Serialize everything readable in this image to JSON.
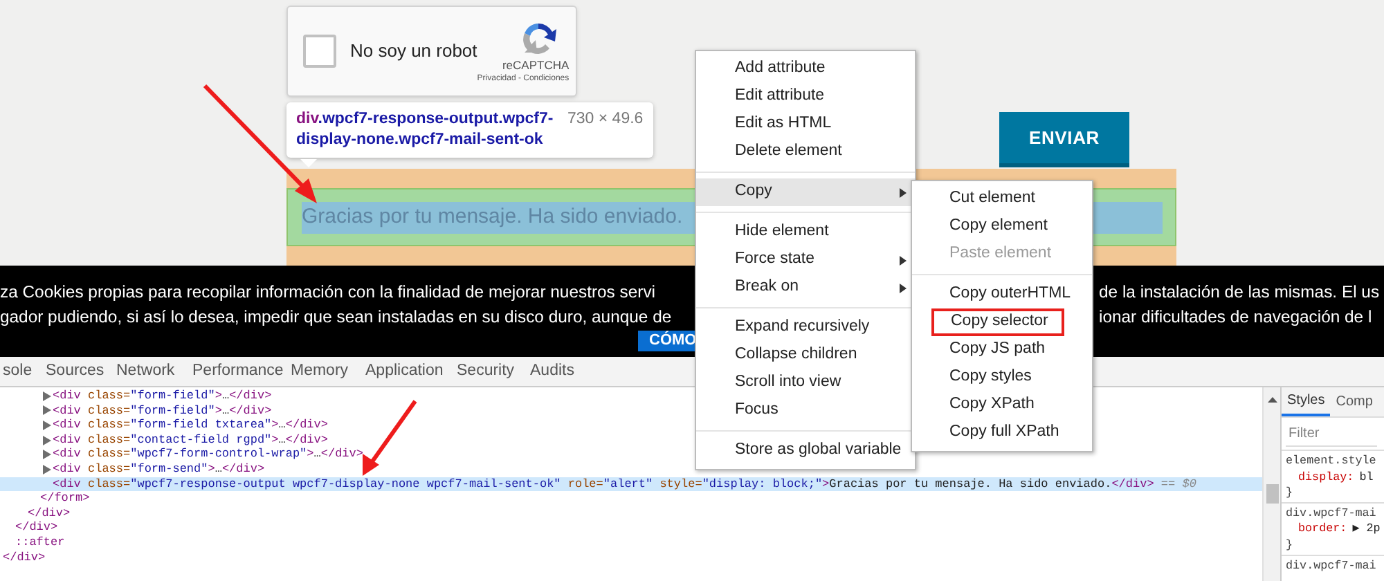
{
  "recaptcha": {
    "label": "No soy un robot",
    "checked": false,
    "brand": "reCAPTCHA",
    "links": "Privacidad - Condiciones"
  },
  "inspect_tooltip": {
    "tag": "div",
    "classes": ".wpcf7-response-output.wpcf7-display-none.wpcf7-mail-sent-ok",
    "size": "730 × 49.6"
  },
  "send_button": {
    "label": "ENVIAR"
  },
  "response_message": "Gracias por tu mensaje. Ha sido enviado.",
  "cookie_banner": {
    "line_1_left": "za Cookies propias para recopilar información con la finalidad de mejorar nuestros servi",
    "line_1_right": "de la instalación de las mismas. El us",
    "line_2_left": "gador pudiendo, si así lo desea, impedir que sean instaladas en su disco duro, aunque de",
    "line_2_right": "ionar dificultades de navegación de l",
    "button": "CÓMO"
  },
  "devtools_tabs": [
    {
      "label": "sole",
      "selected": false
    },
    {
      "label": "Sources",
      "selected": false
    },
    {
      "label": "Network",
      "selected": false
    },
    {
      "label": "Performance",
      "selected": false
    },
    {
      "label": "Memory",
      "selected": false
    },
    {
      "label": "Application",
      "selected": false
    },
    {
      "label": "Security",
      "selected": false
    },
    {
      "label": "Audits",
      "selected": false
    }
  ],
  "dom_tree": [
    {
      "close": [
        {
          "kind": "tag",
          "text": "</div>"
        }
      ],
      "children": [
        {
          "close": [
            {
              "kind": "tag",
              "text": "</div>"
            }
          ],
          "children": [
            {
              "close": [
                {
                  "kind": "tag",
                  "text": "</div>"
                }
              ],
              "children": [
                {
                  "close": [
                    {
                      "kind": "tag",
                      "text": "</form>"
                    }
                  ],
                  "children": [
                    {
                      "expandable": true,
                      "selected": false,
                      "open": [
                        {
                          "kind": "tag",
                          "text": "<div"
                        },
                        {
                          "kind": "attr",
                          "text": " class="
                        },
                        {
                          "kind": "value",
                          "text": "\"form-field\""
                        },
                        {
                          "kind": "tag",
                          "text": ">"
                        },
                        {
                          "kind": "text",
                          "text": "…"
                        },
                        {
                          "kind": "tag",
                          "text": "</div>"
                        }
                      ]
                    },
                    {
                      "expandable": true,
                      "selected": false,
                      "open": [
                        {
                          "kind": "tag",
                          "text": "<div"
                        },
                        {
                          "kind": "attr",
                          "text": " class="
                        },
                        {
                          "kind": "value",
                          "text": "\"form-field\""
                        },
                        {
                          "kind": "tag",
                          "text": ">"
                        },
                        {
                          "kind": "text",
                          "text": "…"
                        },
                        {
                          "kind": "tag",
                          "text": "</div>"
                        }
                      ]
                    },
                    {
                      "expandable": true,
                      "selected": false,
                      "open": [
                        {
                          "kind": "tag",
                          "text": "<div"
                        },
                        {
                          "kind": "attr",
                          "text": " class="
                        },
                        {
                          "kind": "value",
                          "text": "\"form-field txtarea\""
                        },
                        {
                          "kind": "tag",
                          "text": ">"
                        },
                        {
                          "kind": "text",
                          "text": "…"
                        },
                        {
                          "kind": "tag",
                          "text": "</div>"
                        }
                      ]
                    },
                    {
                      "expandable": true,
                      "selected": false,
                      "open": [
                        {
                          "kind": "tag",
                          "text": "<div"
                        },
                        {
                          "kind": "attr",
                          "text": " class="
                        },
                        {
                          "kind": "value",
                          "text": "\"contact-field rgpd\""
                        },
                        {
                          "kind": "tag",
                          "text": ">"
                        },
                        {
                          "kind": "text",
                          "text": "…"
                        },
                        {
                          "kind": "tag",
                          "text": "</div>"
                        }
                      ]
                    },
                    {
                      "expandable": true,
                      "selected": false,
                      "open": [
                        {
                          "kind": "tag",
                          "text": "<div"
                        },
                        {
                          "kind": "attr",
                          "text": " class="
                        },
                        {
                          "kind": "value",
                          "text": "\"wpcf7-form-control-wrap\""
                        },
                        {
                          "kind": "tag",
                          "text": ">"
                        },
                        {
                          "kind": "text",
                          "text": "…"
                        },
                        {
                          "kind": "tag",
                          "text": "</div>"
                        }
                      ]
                    },
                    {
                      "expandable": true,
                      "selected": false,
                      "open": [
                        {
                          "kind": "tag",
                          "text": "<div"
                        },
                        {
                          "kind": "attr",
                          "text": " class="
                        },
                        {
                          "kind": "value",
                          "text": "\"form-send\""
                        },
                        {
                          "kind": "tag",
                          "text": ">"
                        },
                        {
                          "kind": "text",
                          "text": "…"
                        },
                        {
                          "kind": "tag",
                          "text": "</div>"
                        }
                      ]
                    },
                    {
                      "expandable": false,
                      "selected": true,
                      "open": [
                        {
                          "kind": "tag",
                          "text": "<div"
                        },
                        {
                          "kind": "attr",
                          "text": " class="
                        },
                        {
                          "kind": "value",
                          "text": "\"wpcf7-response-output wpcf7-display-none wpcf7-mail-sent-ok\""
                        },
                        {
                          "kind": "attr",
                          "text": " role="
                        },
                        {
                          "kind": "value",
                          "text": "\"alert\""
                        },
                        {
                          "kind": "attr",
                          "text": " style="
                        },
                        {
                          "kind": "value",
                          "text": "\"display: block;\""
                        },
                        {
                          "kind": "tag",
                          "text": ">"
                        },
                        {
                          "kind": "text",
                          "text": "Gracias por tu mensaje. Ha sido enviado."
                        },
                        {
                          "kind": "tag",
                          "text": "</div>"
                        },
                        {
                          "kind": "dim",
                          "text": " == $0"
                        }
                      ]
                    }
                  ]
                }
              ]
            }
          ]
        },
        {
          "open": [
            {
              "kind": "tag",
              "text": "::after"
            }
          ]
        }
      ]
    }
  ],
  "context_menu": [
    {
      "kind": "item",
      "label": "Add attribute",
      "selected": false,
      "has_submenu": false
    },
    {
      "kind": "item",
      "label": "Edit attribute",
      "selected": false,
      "has_submenu": false
    },
    {
      "kind": "item",
      "label": "Edit as HTML",
      "selected": false,
      "has_submenu": false
    },
    {
      "kind": "item",
      "label": "Delete element",
      "selected": false,
      "has_submenu": false
    },
    {
      "kind": "separator"
    },
    {
      "kind": "item",
      "label": "Copy",
      "selected": true,
      "has_submenu": true
    },
    {
      "kind": "separator"
    },
    {
      "kind": "item",
      "label": "Hide element",
      "selected": false,
      "has_submenu": false
    },
    {
      "kind": "item",
      "label": "Force state",
      "selected": false,
      "has_submenu": true
    },
    {
      "kind": "item",
      "label": "Break on",
      "selected": false,
      "has_submenu": true
    },
    {
      "kind": "separator"
    },
    {
      "kind": "item",
      "label": "Expand recursively",
      "selected": false,
      "has_submenu": false
    },
    {
      "kind": "item",
      "label": "Collapse children",
      "selected": false,
      "has_submenu": false
    },
    {
      "kind": "item",
      "label": "Scroll into view",
      "selected": false,
      "has_submenu": false
    },
    {
      "kind": "item",
      "label": "Focus",
      "selected": false,
      "has_submenu": false
    },
    {
      "kind": "separator"
    },
    {
      "kind": "item",
      "label": "Store as global variable",
      "selected": false,
      "has_submenu": false
    }
  ],
  "copy_submenu": [
    {
      "kind": "item",
      "label": "Cut element",
      "disabled": false,
      "highlighted": false
    },
    {
      "kind": "item",
      "label": "Copy element",
      "disabled": false,
      "highlighted": false
    },
    {
      "kind": "item",
      "label": "Paste element",
      "disabled": true,
      "highlighted": false
    },
    {
      "kind": "separator"
    },
    {
      "kind": "item",
      "label": "Copy outerHTML",
      "disabled": false,
      "highlighted": false
    },
    {
      "kind": "item",
      "label": "Copy selector",
      "disabled": false,
      "highlighted": true
    },
    {
      "kind": "item",
      "label": "Copy JS path",
      "disabled": false,
      "highlighted": false
    },
    {
      "kind": "item",
      "label": "Copy styles",
      "disabled": false,
      "highlighted": false
    },
    {
      "kind": "item",
      "label": "Copy XPath",
      "disabled": false,
      "highlighted": false
    },
    {
      "kind": "item",
      "label": "Copy full XPath",
      "disabled": false,
      "highlighted": false
    }
  ],
  "styles_pane": {
    "tabs": [
      {
        "label": "Styles",
        "selected": true
      },
      {
        "label": "Comp",
        "selected": false
      }
    ],
    "filter_placeholder": "Filter",
    "rules": [
      {
        "kind": "selector",
        "text": "element.style"
      },
      {
        "kind": "property",
        "name": "display:",
        "value": "bl"
      },
      {
        "kind": "brace",
        "text": "}"
      },
      {
        "kind": "selector",
        "text": "div.wpcf7-mai"
      },
      {
        "kind": "property",
        "name": "border:",
        "value": "▶ 2p"
      },
      {
        "kind": "brace",
        "text": "}"
      },
      {
        "kind": "selector",
        "text": "div.wpcf7-mai"
      }
    ]
  }
}
